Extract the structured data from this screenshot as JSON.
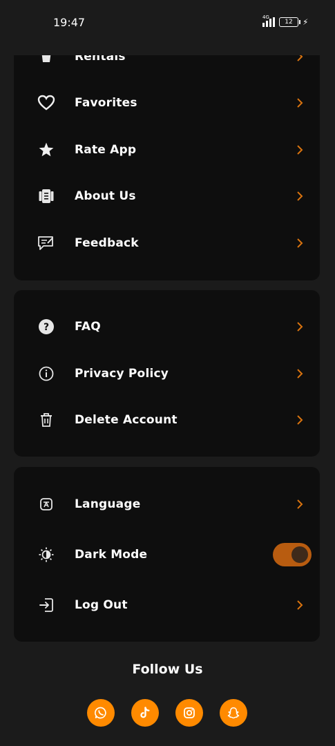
{
  "status_bar": {
    "time": "19:47",
    "network": "4G",
    "battery": "12"
  },
  "menu_card_1": {
    "items": [
      {
        "label": "Rentals",
        "icon": "rentals-icon"
      },
      {
        "label": "Favorites",
        "icon": "heart-icon"
      },
      {
        "label": "Rate App",
        "icon": "star-icon"
      },
      {
        "label": "About Us",
        "icon": "document-icon"
      },
      {
        "label": "Feedback",
        "icon": "feedback-icon"
      }
    ]
  },
  "menu_card_2": {
    "items": [
      {
        "label": "FAQ",
        "icon": "question-icon"
      },
      {
        "label": "Privacy Policy",
        "icon": "info-icon"
      },
      {
        "label": "Delete Account",
        "icon": "trash-icon"
      }
    ]
  },
  "menu_card_3": {
    "items": [
      {
        "label": "Language",
        "icon": "translate-icon"
      },
      {
        "label": "Dark Mode",
        "icon": "dark-mode-icon",
        "toggle_on": true
      },
      {
        "label": "Log Out",
        "icon": "logout-icon"
      }
    ]
  },
  "follow": {
    "title": "Follow Us",
    "socials": [
      {
        "name": "whatsapp-icon"
      },
      {
        "name": "tiktok-icon"
      },
      {
        "name": "instagram-icon"
      },
      {
        "name": "snapchat-icon"
      }
    ]
  },
  "colors": {
    "accent": "#ff8a00",
    "chevron": "#d9730f",
    "background": "#1b1b1b",
    "card": "#0e0e0e",
    "toggle_track": "#b85c10"
  }
}
